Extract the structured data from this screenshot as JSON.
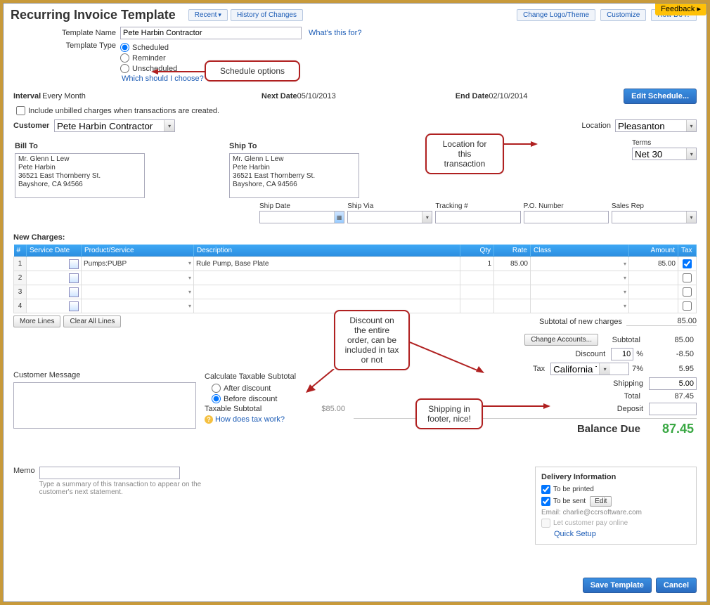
{
  "feedback": "Feedback ▸",
  "header": {
    "title": "Recurring Invoice Template",
    "recent": "Recent",
    "history": "History of Changes",
    "change_logo": "Change Logo/Theme",
    "customize": "Customize",
    "how_do_i": "How Do I?"
  },
  "template": {
    "name_label": "Template Name",
    "name_value": "Pete Harbin Contractor",
    "whats_this": "What's this for?",
    "type_label": "Template Type",
    "type_scheduled": "Scheduled",
    "type_reminder": "Reminder",
    "type_unscheduled": "Unscheduled",
    "which_should": "Which should I choose?"
  },
  "callouts": {
    "schedule": "Schedule options",
    "location": "Location for this\ntransaction",
    "discount": "Discount on\nthe entire\norder, can be\nincluded in tax\nor not",
    "shipping": "Shipping in\nfooter, nice!"
  },
  "schedule": {
    "interval_label": "Interval",
    "interval_value": "Every Month",
    "next_date_label": "Next Date",
    "next_date_value": "05/10/2013",
    "end_date_label": "End Date",
    "end_date_value": "02/10/2014",
    "edit_btn": "Edit Schedule...",
    "include_unbilled": "Include unbilled charges when transactions are created."
  },
  "customer": {
    "label": "Customer",
    "value": "Pete Harbin Contractor",
    "location_label": "Location",
    "location_value": "Pleasanton"
  },
  "billto": {
    "label": "Bill To",
    "text": "Mr. Glenn L Lew\nPete Harbin\n36521 East Thornberry St.\nBayshore, CA  94566"
  },
  "shipto": {
    "label": "Ship To",
    "text": "Mr. Glenn L Lew\nPete Harbin\n36521 East Thornberry St.\nBayshore, CA  94566"
  },
  "terms": {
    "label": "Terms",
    "value": "Net 30"
  },
  "shipgrid": {
    "ship_date": "Ship Date",
    "ship_via": "Ship Via",
    "tracking": "Tracking #",
    "po": "P.O. Number",
    "sales_rep": "Sales Rep"
  },
  "charges": {
    "title": "New Charges:",
    "cols": {
      "num": "#",
      "service_date": "Service Date",
      "product": "Product/Service",
      "desc": "Description",
      "qty": "Qty",
      "rate": "Rate",
      "class": "Class",
      "amount": "Amount",
      "tax": "Tax"
    },
    "rows": [
      {
        "n": "1",
        "product": "Pumps:PUBP",
        "desc": "Rule Pump, Base Plate",
        "qty": "1",
        "rate": "85.00",
        "amount": "85.00",
        "tax": true
      },
      {
        "n": "2"
      },
      {
        "n": "3"
      },
      {
        "n": "4"
      }
    ],
    "more_lines": "More Lines",
    "clear_all": "Clear All Lines"
  },
  "customer_msg_label": "Customer Message",
  "calc": {
    "title": "Calculate Taxable Subtotal",
    "after": "After discount",
    "before": "Before discount",
    "taxable_label": "Taxable Subtotal",
    "taxable_value": "$85.00",
    "how_tax": "How does tax work?"
  },
  "totals": {
    "subtotal_charges_label": "Subtotal of new charges",
    "subtotal_charges": "85.00",
    "change_accounts": "Change Accounts...",
    "subtotal_label": "Subtotal",
    "subtotal": "85.00",
    "discount_label": "Discount",
    "discount_pct": "10",
    "discount_val": "-8.50",
    "tax_label": "Tax",
    "tax_name": "California Tax",
    "tax_pct": "7%",
    "tax_val": "5.95",
    "shipping_label": "Shipping",
    "shipping_val": "5.00",
    "total_label": "Total",
    "total_val": "87.45",
    "deposit_label": "Deposit",
    "balance_label": "Balance Due",
    "balance_val": "87.45"
  },
  "memo": {
    "label": "Memo",
    "hint": "Type a summary of this transaction to appear on the customer's next statement."
  },
  "delivery": {
    "title": "Delivery Information",
    "to_be_printed": "To be printed",
    "to_be_sent": "To be sent",
    "edit": "Edit",
    "email_label": "Email:",
    "email_value": "charlie@ccrsoftware.com",
    "pay_online": "Let customer pay online",
    "quick_setup": "Quick Setup"
  },
  "footer": {
    "save": "Save Template",
    "cancel": "Cancel"
  }
}
